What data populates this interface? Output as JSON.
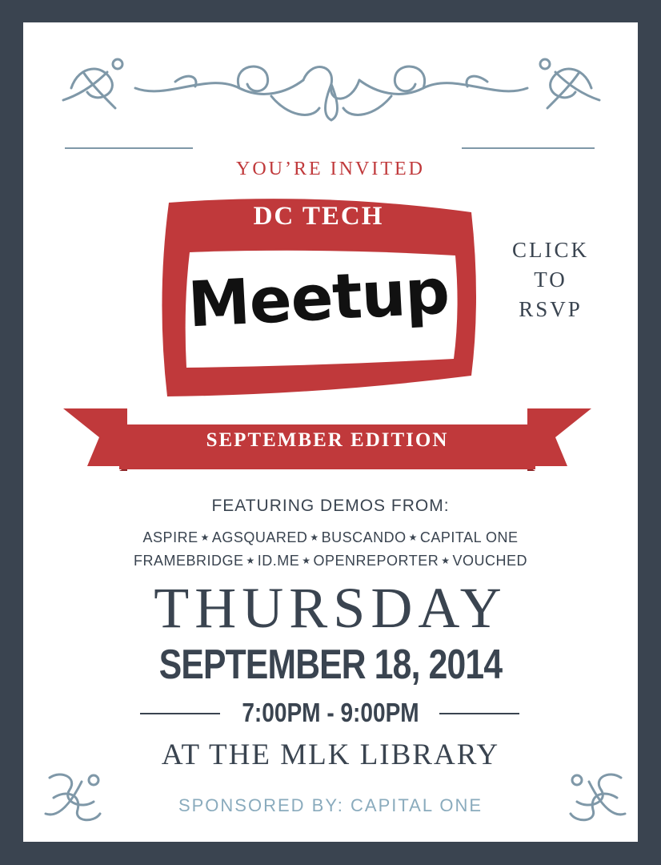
{
  "header": {
    "invited": "YOU’RE INVITED"
  },
  "nametag": {
    "title": "DC TECH",
    "handwritten": "Meetup"
  },
  "rsvp": {
    "line1": "CLICK",
    "line2": "TO",
    "line3": "RSVP"
  },
  "banner": {
    "edition": "SEPTEMBER EDITION"
  },
  "featuring": {
    "heading": "FEATURING DEMOS FROM:",
    "row1": [
      "ASPIRE",
      "AGSQUARED",
      "BUSCANDO",
      "CAPITAL ONE"
    ],
    "row2": [
      "FRAMEBRIDGE",
      "ID.ME",
      "OPENREPORTER",
      "VOUCHED"
    ]
  },
  "event": {
    "day": "THURSDAY",
    "date": "SEPTEMBER 18, 2014",
    "time": "7:00PM - 9:00PM",
    "location": "AT THE MLK LIBRARY"
  },
  "sponsor": "SPONSORED BY: CAPITAL ONE",
  "colors": {
    "border": "#3a4450",
    "accent_red": "#c0393b",
    "flourish_blue": "#7f98a8",
    "sponsor_blue": "#8aabbd"
  },
  "icons": {
    "separator": "star-icon",
    "decoration": "flourish-ornament"
  }
}
